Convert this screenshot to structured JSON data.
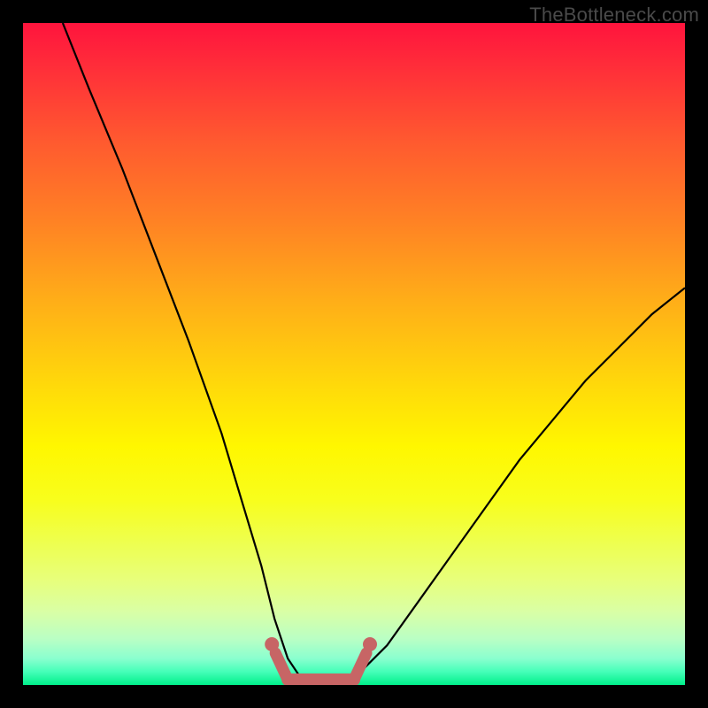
{
  "attribution": "TheBottleneck.com",
  "colors": {
    "background": "#000000",
    "curve": "#000000",
    "flat_marker": "#c76565",
    "gradient_stops": [
      "#ff143d",
      "#ff2b3a",
      "#ff5a2f",
      "#ff8224",
      "#ffae18",
      "#ffda0a",
      "#fff700",
      "#f8fe1c",
      "#edff53",
      "#e8ff7a",
      "#d9ffa6",
      "#baffc4",
      "#8affcf",
      "#45ffb8",
      "#00ef8a"
    ]
  },
  "chart_data": {
    "type": "line",
    "title": "",
    "xlabel": "",
    "ylabel": "",
    "xlim": [
      0,
      100
    ],
    "ylim": [
      0,
      100
    ],
    "series": [
      {
        "name": "bottleneck-curve",
        "x": [
          6,
          10,
          15,
          20,
          25,
          30,
          33,
          36,
          38,
          40,
          42,
          44,
          46,
          48,
          50,
          55,
          60,
          65,
          70,
          75,
          80,
          85,
          90,
          95,
          100
        ],
        "y": [
          100,
          90,
          78,
          65,
          52,
          38,
          28,
          18,
          10,
          4,
          1,
          0,
          0,
          0,
          1,
          6,
          13,
          20,
          27,
          34,
          40,
          46,
          51,
          56,
          60
        ]
      }
    ],
    "flat_region": {
      "x_start": 40,
      "x_end": 50,
      "y": 0
    },
    "annotations": [
      {
        "text": "TheBottleneck.com",
        "position": "top-right"
      }
    ]
  }
}
